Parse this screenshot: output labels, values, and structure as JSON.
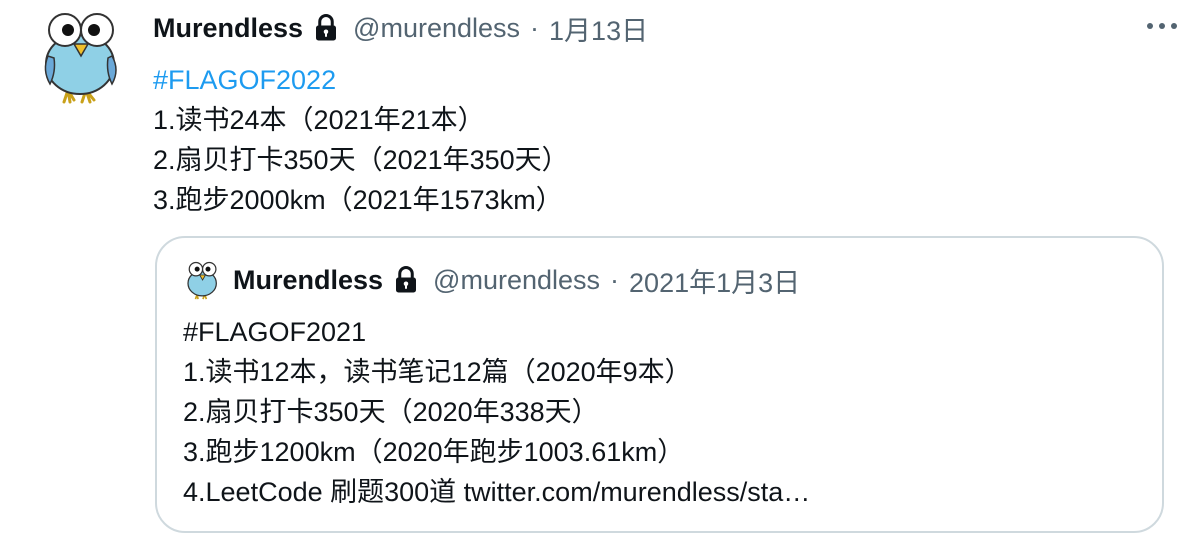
{
  "tweet": {
    "author_name": "Murendless",
    "handle": "@murendless",
    "separator": "·",
    "date": "1月13日",
    "hashtag": "#FLAGOF2022",
    "lines": [
      "1.读书24本（2021年21本）",
      "2.扇贝打卡350天（2021年350天）",
      "3.跑步2000km（2021年1573km）"
    ]
  },
  "quoted_tweet": {
    "author_name": "Murendless",
    "handle": "@murendless",
    "separator": "·",
    "date": "2021年1月3日",
    "lines": [
      "#FLAGOF2021",
      "1.读书12本，读书笔记12篇（2020年9本）",
      "2.扇贝打卡350天（2020年338天）",
      "3.跑步1200km（2020年跑步1003.61km）",
      "4.LeetCode 刷题300道 twitter.com/murendless/sta…"
    ]
  },
  "colors": {
    "accent": "#1d9bf0",
    "secondary_text": "#536471",
    "border": "#cfd9de",
    "text": "#0f1419"
  },
  "icons": {
    "avatar": "owl-avatar-icon",
    "lock": "lock-icon",
    "more": "more-horizontal-icon"
  }
}
